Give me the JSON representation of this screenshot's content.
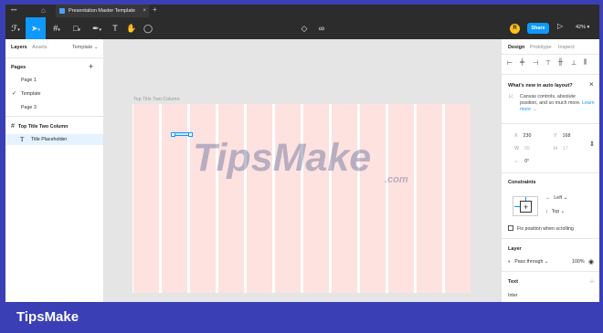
{
  "titlebar": {
    "tab_title": "Presentation Master Template",
    "menu_dots": "•••",
    "home_icon": "home-icon",
    "close_glyph": "×",
    "new_tab_glyph": "+"
  },
  "toolbar": {
    "tools": [
      "main-menu",
      "move-tool",
      "frame-tool",
      "shape-tool",
      "pen-tool",
      "text-tool",
      "hand-tool",
      "comment-tool"
    ],
    "avatar_initial": "R",
    "share_label": "Share",
    "zoom": "42%",
    "accent": "#0d99ff"
  },
  "left_panel": {
    "tabs": {
      "layers": "Layers",
      "assets": "Assets",
      "template": "Template ⌄"
    },
    "pages_title": "Pages",
    "add_glyph": "+",
    "pages": [
      "Page 1",
      "Template",
      "Page 3"
    ],
    "active_page_index": 1,
    "check_glyph": "✓",
    "layers": {
      "frame_name": "Top Title Two Column",
      "text_name": "Title Placeholder",
      "text_icon_glyph": "T",
      "frame_icon_glyph": "#"
    }
  },
  "canvas": {
    "frame_label": "Top Title Two Column",
    "frame_fill": "#ffffff",
    "column_fill": "#fde2e0",
    "column_count": 12,
    "watermark": "TipsMake",
    "watermark_suffix": ".com"
  },
  "right_panel": {
    "tabs": {
      "design": "Design",
      "prototype": "Prototype",
      "inspect": "Inspect"
    },
    "whats_new": {
      "title": "What's new in auto layout?",
      "body": "Canvas controls, absolute position, and so much more.",
      "link": "Learn more →",
      "close_glyph": "×"
    },
    "position": {
      "x_label": "X",
      "x": "230",
      "y_label": "Y",
      "y": "168"
    },
    "size": {
      "w_label": "W",
      "w": "95",
      "h_label": "H",
      "h": "17"
    },
    "rotation": {
      "label": "∟",
      "value": "0°"
    },
    "constraints": {
      "title": "Constraints",
      "horizontal": "Left",
      "vertical": "Top",
      "fix_position": "Fix position when scrolling"
    },
    "layer": {
      "title": "Layer",
      "blend": "Pass through",
      "opacity": "100%"
    },
    "text": {
      "title": "Text",
      "font": "Inter"
    }
  },
  "footer": {
    "brand": "TipsMake"
  }
}
